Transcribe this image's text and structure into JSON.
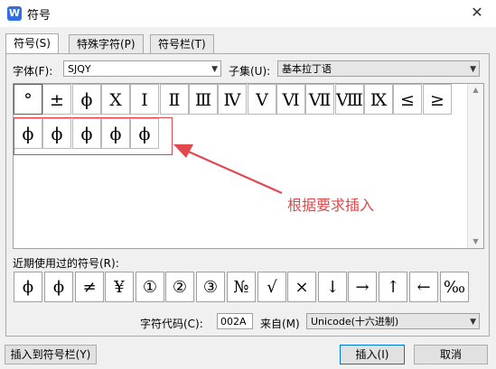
{
  "window": {
    "title": "符号",
    "close_glyph": "✕",
    "app_icon_glyph": "W"
  },
  "tabs": [
    {
      "label": "符号(S)"
    },
    {
      "label": "特殊字符(P)"
    },
    {
      "label": "符号栏(T)"
    }
  ],
  "font": {
    "label": "字体(F):",
    "value": "SJQY"
  },
  "subset": {
    "label": "子集(U):",
    "value": "基本拉丁语"
  },
  "symbol_grid": {
    "row1": [
      "°",
      "±",
      "ϕ",
      "X",
      "I",
      "Ⅱ",
      "Ⅲ",
      "Ⅳ",
      "Ⅴ",
      "Ⅵ",
      "Ⅶ",
      "Ⅷ",
      "Ⅸ",
      "≤",
      "≥"
    ],
    "row2": [
      "ϕ",
      "ϕ",
      "ϕ",
      "ϕ",
      "ϕ"
    ]
  },
  "annotation": {
    "text": "根据要求插入",
    "color": "#e0484d"
  },
  "recent": {
    "label": "近期使用过的符号(R):",
    "symbols": [
      "ϕ",
      "ϕ",
      "≠",
      "¥",
      "①",
      "②",
      "③",
      "№",
      "√",
      "×",
      "↓",
      "→",
      "↑",
      "←",
      "‰"
    ]
  },
  "char_code": {
    "label": "字符代码(C):",
    "value": "002A"
  },
  "from": {
    "label": "来自(M)",
    "value": "Unicode(十六进制)"
  },
  "buttons": {
    "insert_to_bar": "插入到符号栏(Y)",
    "insert": "插入(I)",
    "cancel": "取消"
  }
}
